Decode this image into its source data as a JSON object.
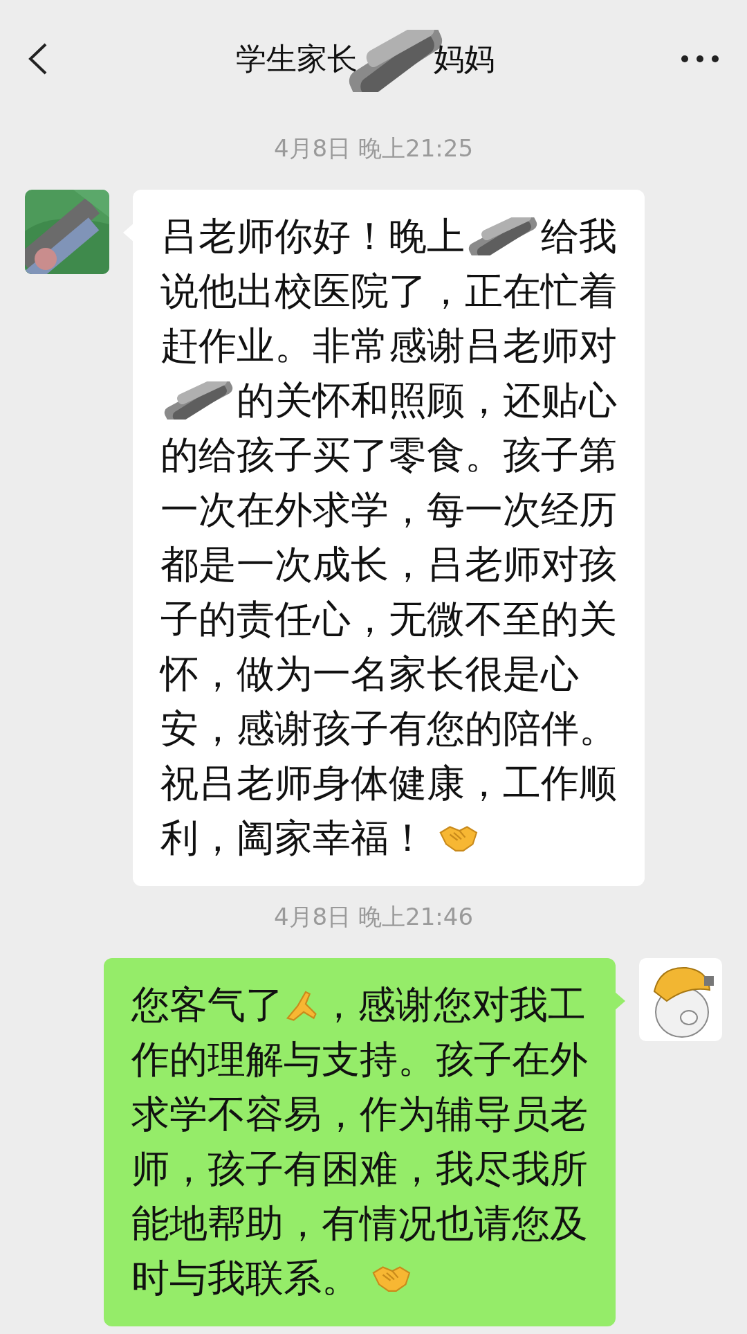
{
  "header": {
    "title_parts": [
      {
        "kind": "text",
        "text": "学生家长"
      },
      {
        "kind": "redacted"
      },
      {
        "kind": "text",
        "text": "妈妈"
      }
    ]
  },
  "messages": [
    {
      "kind": "timestamp",
      "text": "4月8日 晚上21:25"
    },
    {
      "kind": "incoming",
      "lines": [
        [
          {
            "kind": "text",
            "text": "吕老师你好！晚上"
          },
          {
            "kind": "redacted"
          },
          {
            "kind": "text",
            "text": "给我"
          }
        ],
        [
          {
            "kind": "text",
            "text": "说他出校医院了，正在忙着"
          }
        ],
        [
          {
            "kind": "text",
            "text": "赶作业。非常感谢吕老师对"
          }
        ],
        [
          {
            "kind": "redacted"
          },
          {
            "kind": "text",
            "text": "的关怀和照顾，还贴心"
          }
        ],
        [
          {
            "kind": "text",
            "text": "的给孩子买了零食。孩子第"
          }
        ],
        [
          {
            "kind": "text",
            "text": "一次在外求学，每一次经历"
          }
        ],
        [
          {
            "kind": "text",
            "text": "都是一次成长，吕老师对孩"
          }
        ],
        [
          {
            "kind": "text",
            "text": "子的责任心，无微不至的关"
          }
        ],
        [
          {
            "kind": "text",
            "text": "怀，做为一名家长很是心"
          }
        ],
        [
          {
            "kind": "text",
            "text": "安，感谢孩子有您的陪伴。"
          }
        ],
        [
          {
            "kind": "text",
            "text": "祝吕老师身体健康，工作顺"
          }
        ],
        [
          {
            "kind": "text",
            "text": "利，阖家幸福！"
          },
          {
            "kind": "handshake"
          }
        ]
      ]
    },
    {
      "kind": "timestamp",
      "text": "4月8日 晚上21:46"
    },
    {
      "kind": "outgoing",
      "lines": [
        [
          {
            "kind": "text",
            "text": "您客气了"
          },
          {
            "kind": "pray"
          },
          {
            "kind": "text",
            "text": "，感谢您对我工"
          }
        ],
        [
          {
            "kind": "text",
            "text": "作的理解与支持。孩子在外"
          }
        ],
        [
          {
            "kind": "text",
            "text": "求学不容易，作为辅导员老"
          }
        ],
        [
          {
            "kind": "text",
            "text": "师，孩子有困难，我尽我所"
          }
        ],
        [
          {
            "kind": "text",
            "text": "能地帮助，有情况也请您及"
          }
        ],
        [
          {
            "kind": "text",
            "text": "时与我联系。"
          },
          {
            "kind": "handshake"
          }
        ]
      ]
    }
  ]
}
